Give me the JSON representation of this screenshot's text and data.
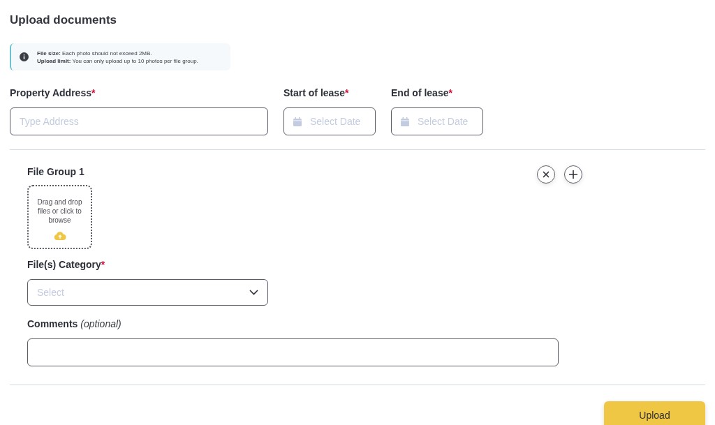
{
  "title": "Upload documents",
  "info": {
    "lines": [
      "**File size:** Each photo should not exceed 2MB.",
      "**Upload limit:** You can only upload up to 10 photos per file group."
    ]
  },
  "fields": [
    {
      "kind": "text",
      "label": "Property Address",
      "required_mark": "*",
      "placeholder": "Type Address"
    },
    {
      "kind": "date",
      "label": "Start of lease",
      "required_mark": "*",
      "placeholder": "Select Date"
    },
    {
      "kind": "date",
      "label": "End of lease",
      "required_mark": "*",
      "placeholder": "Select Date"
    }
  ],
  "file_group": {
    "title": "File Group 1",
    "dropzone": "Drag and drop files or click to browse",
    "category": {
      "label": "File(s) Category",
      "required_mark": "*",
      "placeholder": "Select"
    },
    "comments": {
      "label": "Comments",
      "hint": "(optional)"
    }
  },
  "upload_button": "Upload"
}
